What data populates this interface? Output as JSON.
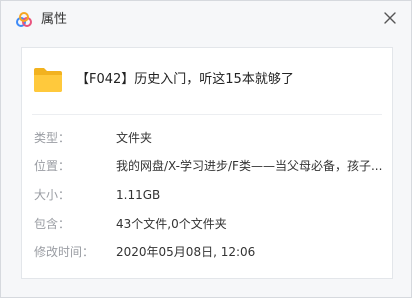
{
  "window": {
    "title": "属性",
    "logo_icon": "cloud-rings-logo",
    "close_icon": "close-icon"
  },
  "file": {
    "icon": "folder-icon",
    "name": "【F042】历史入门，听这15本就够了"
  },
  "properties": [
    {
      "label": "类型：",
      "value": "文件夹"
    },
    {
      "label": "位置：",
      "value": "我的网盘/X-学习进步/F类——当父母必备，孩子..."
    },
    {
      "label": "大小：",
      "value": "1.11GB"
    },
    {
      "label": "包含：",
      "value": "43个文件,0个文件夹"
    },
    {
      "label": "修改时间：",
      "value": "2020年05月08日, 12:06"
    }
  ],
  "colors": {
    "folder_yellow": "#ffc93c",
    "logo_pink": "#e9537e",
    "logo_blue": "#3d8af7",
    "label_gray": "#9a9da3",
    "value_dark": "#333333"
  }
}
